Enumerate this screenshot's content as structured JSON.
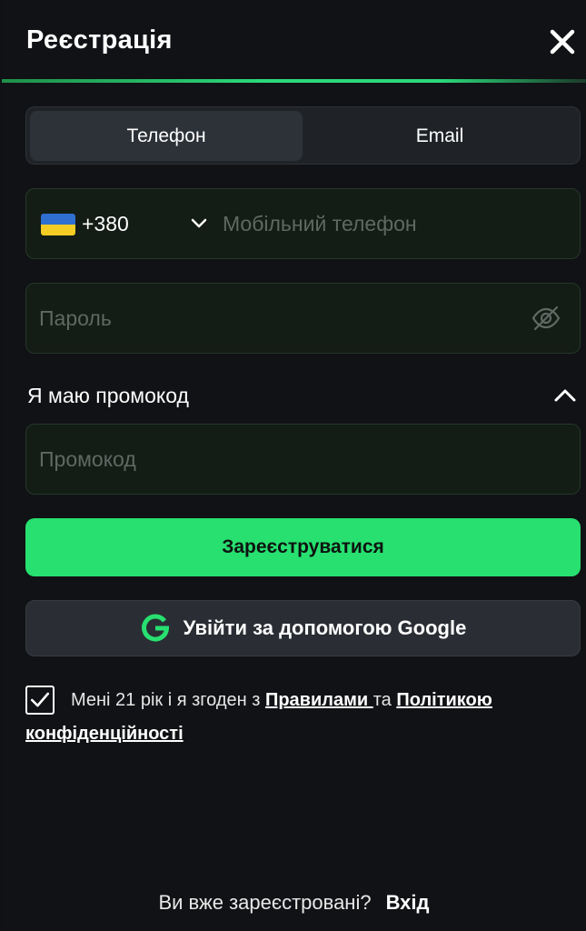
{
  "header": {
    "title": "Реєстрація",
    "close_icon": "close-icon"
  },
  "tabs": [
    {
      "label": "Телефон",
      "active": true
    },
    {
      "label": "Email",
      "active": false
    }
  ],
  "phone": {
    "flag_icon": "ukraine-flag-icon",
    "country_code": "+380",
    "placeholder": "Мобільний телефон"
  },
  "password": {
    "placeholder": "Пароль",
    "toggle_icon": "eye-off-icon"
  },
  "promo": {
    "label": "Я маю промокод",
    "placeholder": "Промокод",
    "expanded": true
  },
  "buttons": {
    "register_label": "Зареєструватися",
    "google_label": "Увійти за допомогою Google"
  },
  "agreement": {
    "checked": true,
    "prefix": "Мені 21 рік і я згоден з ",
    "rules_link": "Правилами ",
    "middle": "та ",
    "privacy_link": "Політикою конфіденційності"
  },
  "footer": {
    "question": "Ви вже зареєстровані?",
    "login_link": "Вхід"
  },
  "colors": {
    "accent": "#27e070",
    "background": "#111215",
    "field_bg": "#131c15"
  }
}
